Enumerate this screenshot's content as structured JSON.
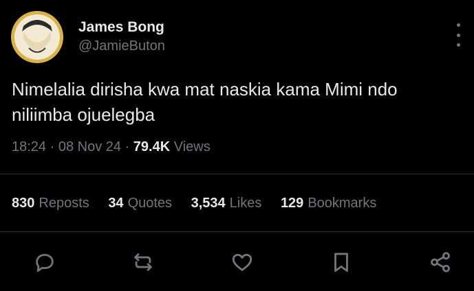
{
  "author": {
    "display_name": "James Bong",
    "handle": "@JamieButon",
    "avatar_icon": "avatar-photo"
  },
  "tweet": {
    "text": "Nimelalia dirisha kwa mat naskia kama Mimi ndo\nniliimba ojuelegba",
    "time": "18:24",
    "date": "08 Nov 24",
    "views_count": "79.4K",
    "views_label": "Views"
  },
  "stats": {
    "reposts": {
      "count": "830",
      "label": "Reposts"
    },
    "quotes": {
      "count": "34",
      "label": "Quotes"
    },
    "likes": {
      "count": "3,534",
      "label": "Likes"
    },
    "bookmarks": {
      "count": "129",
      "label": "Bookmarks"
    }
  },
  "actions": [
    "reply-icon",
    "repost-icon",
    "like-icon",
    "bookmark-icon",
    "share-icon"
  ],
  "colors": {
    "background": "#000000",
    "primary_text": "#e7e9ea",
    "secondary_text": "#71767b",
    "divider": "#2f3336",
    "avatar_ring": "#d9b24a"
  }
}
